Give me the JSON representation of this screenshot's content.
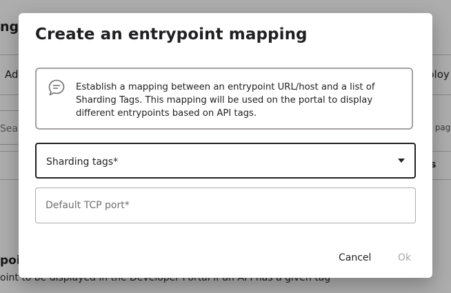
{
  "background": {
    "page_title": "ng",
    "tab_left": "Ad",
    "tab_right": "ploy",
    "search_placeholder": "Sea",
    "per_page": "r page",
    "column_header": "s",
    "section_title": "poi",
    "section_description": "oint to be displayed in the Developer Portal if an API has a given tag"
  },
  "dialog": {
    "title": "Create an entrypoint mapping",
    "info_icon": "chat-bubble-icon",
    "info_text": "Establish a mapping between an entrypoint URL/host and a list of Sharding Tags. This mapping will be used on the portal to display different entrypoints based on API tags.",
    "sharding_tags": {
      "label": "Sharding tags*",
      "icon": "chevron-down-icon"
    },
    "tcp_port": {
      "placeholder": "Default TCP port*",
      "value": ""
    },
    "actions": {
      "cancel_label": "Cancel",
      "ok_label": "Ok"
    }
  },
  "colors": {
    "overlay": "#000000",
    "text": "#1f1f21",
    "info_border": "#a29f9f",
    "disabled": "#a6a6a6"
  }
}
